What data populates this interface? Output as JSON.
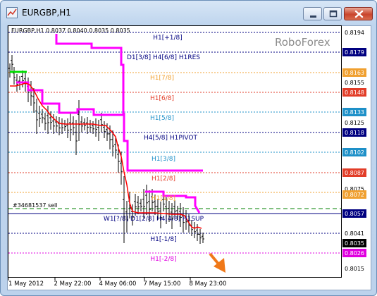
{
  "window": {
    "title": "EURGBP,H1",
    "minimize_icon": "minimize-icon",
    "maximize_icon": "maximize-icon",
    "close_icon": "close-icon"
  },
  "chart": {
    "header": "EURGBP,H1  0.8037 0.8040 0.8035 0.8035",
    "watermark": "RoboForex",
    "order_label": "#34681537 sell",
    "level_labels": [
      {
        "text": "H1[+1/8]",
        "color": "#000080"
      },
      {
        "text": "D1[3/8] H4[6/8] H1RES",
        "color": "#000080"
      },
      {
        "text": "H1[7/8]",
        "color": "#f0a030"
      },
      {
        "text": "H1[6/8]",
        "color": "#e23d28"
      },
      {
        "text": "H1[5/8]",
        "color": "#1e90c8"
      },
      {
        "text": "H4[5/8] H1PIVOT",
        "color": "#000080"
      },
      {
        "text": "H1[3/8]",
        "color": "#1e90c8"
      },
      {
        "text": "H1[2/8]",
        "color": "#e23d28"
      },
      {
        "text": "H1[1/8]",
        "color": "#f0a030"
      },
      {
        "text": "W1[?/8] D1[2/8] H4[4/8] H1SUP",
        "color": "#000080"
      },
      {
        "text": "H1[-1/8]",
        "color": "#000080"
      },
      {
        "text": "H1[-2/8]",
        "color": "#e000e0"
      }
    ],
    "price_tags": [
      {
        "text": "0.8194",
        "bg": "#ffffff",
        "fg": "#000000"
      },
      {
        "text": "0.8179",
        "bg": "#000080",
        "fg": "#ffffff"
      },
      {
        "text": "0.8163",
        "bg": "#f0a030",
        "fg": "#ffffff"
      },
      {
        "text": "0.8155",
        "bg": "#ffffff",
        "fg": "#000000"
      },
      {
        "text": "0.8148",
        "bg": "#e23d28",
        "fg": "#ffffff"
      },
      {
        "text": "0.8133",
        "bg": "#1e90c8",
        "fg": "#ffffff"
      },
      {
        "text": "0.8125",
        "bg": "#ffffff",
        "fg": "#000000"
      },
      {
        "text": "0.8118",
        "bg": "#000080",
        "fg": "#ffffff"
      },
      {
        "text": "0.8102",
        "bg": "#1e90c8",
        "fg": "#ffffff"
      },
      {
        "text": "0.8087",
        "bg": "#e23d28",
        "fg": "#ffffff"
      },
      {
        "text": "0.8075",
        "bg": "#ffffff",
        "fg": "#000000"
      },
      {
        "text": "0.8072",
        "bg": "#f0a030",
        "fg": "#ffffff"
      },
      {
        "text": "0.8057",
        "bg": "#000080",
        "fg": "#ffffff"
      },
      {
        "text": "0.8041",
        "bg": "#ffffff",
        "fg": "#000000"
      },
      {
        "text": "0.8035",
        "bg": "#000000",
        "fg": "#ffffff"
      },
      {
        "text": "0.8026",
        "bg": "#e000e0",
        "fg": "#ffffff"
      },
      {
        "text": "0.8015",
        "bg": "#ffffff",
        "fg": "#000000"
      }
    ],
    "time_labels": [
      "1 May 2012",
      "2 May 22:00",
      "4 May 06:00",
      "7 May 15:00",
      "8 May 23:00"
    ],
    "colors": {
      "magenta": "#ff00ff",
      "red": "#ff0000",
      "green": "#00dd00",
      "navy": "#000080",
      "orange_arrow": "#f07818"
    }
  }
}
